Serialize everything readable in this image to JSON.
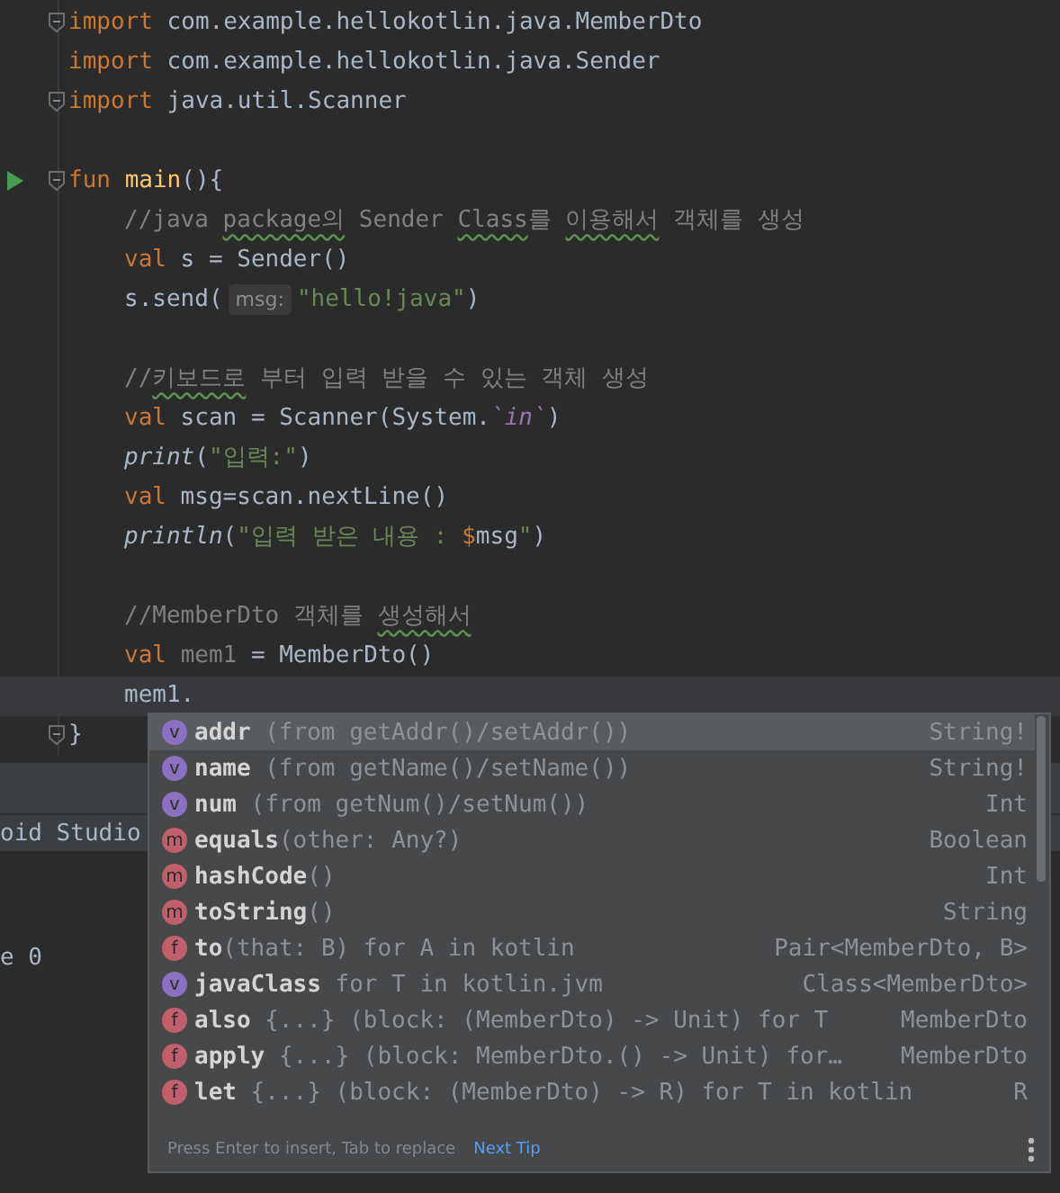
{
  "editor": {
    "lines": [
      {
        "kind": "code",
        "fold": true,
        "tokens": [
          {
            "kind": "kw",
            "t": "import"
          },
          {
            "kind": "plain",
            "t": " com.example.hellokotlin.java.MemberDto"
          }
        ]
      },
      {
        "kind": "code",
        "tokens": [
          {
            "kind": "kw",
            "t": "import"
          },
          {
            "kind": "plain",
            "t": " com.example.hellokotlin.java.Sender"
          }
        ]
      },
      {
        "kind": "code",
        "fold": true,
        "tokens": [
          {
            "kind": "kw",
            "t": "import"
          },
          {
            "kind": "plain",
            "t": " java.util.Scanner"
          }
        ]
      },
      {
        "kind": "blank"
      },
      {
        "kind": "code",
        "fold": true,
        "runnable": true,
        "tokens": [
          {
            "kind": "kw",
            "t": "fun "
          },
          {
            "kind": "fn",
            "t": "main"
          },
          {
            "kind": "plain",
            "t": "(){"
          }
        ]
      },
      {
        "kind": "code",
        "indent": true,
        "tokens": [
          {
            "kind": "comment",
            "t": "//java "
          },
          {
            "kind": "typo",
            "t": "package의"
          },
          {
            "kind": "comment",
            "t": " Sender "
          },
          {
            "kind": "typo",
            "t": "Class"
          },
          {
            "kind": "comment",
            "t": "를 "
          },
          {
            "kind": "typo",
            "t": "이용해서"
          },
          {
            "kind": "comment",
            "t": " 객체를 생성"
          }
        ]
      },
      {
        "kind": "code",
        "indent": true,
        "tokens": [
          {
            "kind": "kw",
            "t": "val"
          },
          {
            "kind": "plain",
            "t": " s = Sender()"
          }
        ]
      },
      {
        "kind": "code",
        "indent": true,
        "tokens": [
          {
            "kind": "plain",
            "t": "s.send("
          },
          {
            "kind": "hint",
            "t": "msg:"
          },
          {
            "kind": "string",
            "t": "\"hello!java\""
          },
          {
            "kind": "plain",
            "t": ")"
          }
        ]
      },
      {
        "kind": "blank"
      },
      {
        "kind": "code",
        "indent": true,
        "tokens": [
          {
            "kind": "comment",
            "t": "//"
          },
          {
            "kind": "typo",
            "t": "키보드로"
          },
          {
            "kind": "comment",
            "t": " 부터 입력 받을 수 있는 객체 생성"
          }
        ]
      },
      {
        "kind": "code",
        "indent": true,
        "tokens": [
          {
            "kind": "kw",
            "t": "val"
          },
          {
            "kind": "plain",
            "t": " scan = Scanner(System."
          },
          {
            "kind": "static",
            "t": "`in`"
          },
          {
            "kind": "plain",
            "t": ")"
          }
        ]
      },
      {
        "kind": "code",
        "indent": true,
        "tokens": [
          {
            "kind": "italic",
            "t": "print"
          },
          {
            "kind": "plain",
            "t": "("
          },
          {
            "kind": "string",
            "t": "\"입력:\""
          },
          {
            "kind": "plain",
            "t": ")"
          }
        ]
      },
      {
        "kind": "code",
        "indent": true,
        "tokens": [
          {
            "kind": "kw",
            "t": "val"
          },
          {
            "kind": "plain",
            "t": " msg=scan.nextLine()"
          }
        ]
      },
      {
        "kind": "code",
        "indent": true,
        "tokens": [
          {
            "kind": "italic",
            "t": "println"
          },
          {
            "kind": "plain",
            "t": "("
          },
          {
            "kind": "string",
            "t": "\"입력 받은 내용 : "
          },
          {
            "kind": "template",
            "t": "$"
          },
          {
            "kind": "plain",
            "t": "msg"
          },
          {
            "kind": "string",
            "t": "\""
          },
          {
            "kind": "plain",
            "t": ")"
          }
        ]
      },
      {
        "kind": "blank"
      },
      {
        "kind": "code",
        "indent": true,
        "tokens": [
          {
            "kind": "comment",
            "t": "//MemberDto 객체를 "
          },
          {
            "kind": "typo",
            "t": "생성해서"
          }
        ]
      },
      {
        "kind": "code",
        "indent": true,
        "tokens": [
          {
            "kind": "kw",
            "t": "val "
          },
          {
            "kind": "unused",
            "t": "mem1"
          },
          {
            "kind": "plain",
            "t": " = MemberDto()"
          }
        ]
      },
      {
        "kind": "code",
        "indent": true,
        "current": true,
        "tokens": [
          {
            "kind": "plain",
            "t": "mem1."
          }
        ]
      },
      {
        "kind": "code",
        "fold": true,
        "tokens": [
          {
            "kind": "plain",
            "t": "}"
          }
        ]
      }
    ]
  },
  "tool_window": {
    "title": "oid Studio",
    "line": "e 0"
  },
  "completion": {
    "items": [
      {
        "kind": "property",
        "letter": "v",
        "name": "addr",
        "detail": "(from getAddr()/setAddr())",
        "spaced": true,
        "type": "String!",
        "selected": true
      },
      {
        "kind": "property",
        "letter": "v",
        "name": "name",
        "detail": "(from getName()/setName())",
        "spaced": true,
        "type": "String!",
        "selected": false
      },
      {
        "kind": "property",
        "letter": "v",
        "name": "num",
        "detail": "(from getNum()/setNum())",
        "spaced": true,
        "type": "Int",
        "selected": false
      },
      {
        "kind": "method",
        "letter": "m",
        "name": "equals",
        "detail": "(other: Any?)",
        "spaced": false,
        "type": "Boolean",
        "selected": false
      },
      {
        "kind": "method",
        "letter": "m",
        "name": "hashCode",
        "detail": "()",
        "spaced": false,
        "type": "Int",
        "selected": false
      },
      {
        "kind": "method",
        "letter": "m",
        "name": "toString",
        "detail": "()",
        "spaced": false,
        "type": "String",
        "selected": false
      },
      {
        "kind": "function",
        "letter": "f",
        "name": "to",
        "detail": "(that: B) for A in kotlin",
        "spaced": false,
        "type": "Pair<MemberDto, B>",
        "selected": false
      },
      {
        "kind": "property",
        "letter": "v",
        "name": "javaClass",
        "detail": "for T in kotlin.jvm",
        "spaced": true,
        "type": "Class<MemberDto>",
        "selected": false
      },
      {
        "kind": "function",
        "letter": "f",
        "name": "also",
        "detail": "{...} (block: (MemberDto) -> Unit) for T",
        "spaced": true,
        "type": "MemberDto",
        "selected": false
      },
      {
        "kind": "function",
        "letter": "f",
        "name": "apply",
        "detail": "{...} (block: MemberDto.() -> Unit) for…",
        "spaced": true,
        "type": "MemberDto",
        "selected": false
      },
      {
        "kind": "function",
        "letter": "f",
        "name": "let",
        "detail": "{...} (block: (MemberDto) -> R) for T in kotlin",
        "spaced": true,
        "type": "R",
        "selected": false
      }
    ],
    "footer_hint": "Press Enter to insert, Tab to replace",
    "tip_link": "Next Tip"
  }
}
